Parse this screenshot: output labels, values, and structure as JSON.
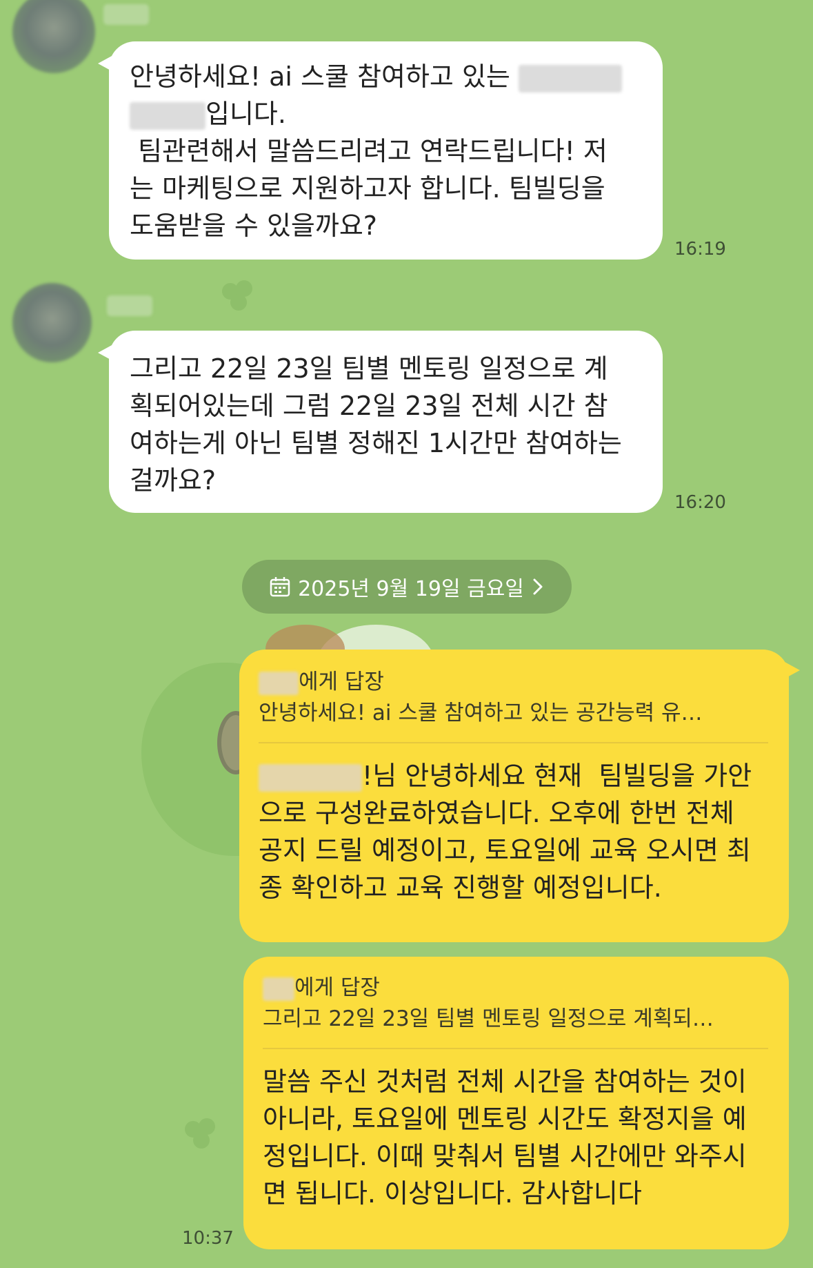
{
  "chat": {
    "messages": [
      {
        "direction": "incoming",
        "text_lines": [
          "안녕하세요! ai 스쿨 참여하고 있는 ",
          "입니다.",
          " 팀관련해서 말씀드리려고 연락드립니다! 저",
          "는 마케팅으로 지원하고자 합니다. 팀빌딩을",
          "도움받을 수 있을까요?"
        ],
        "time": "16:19"
      },
      {
        "direction": "incoming",
        "text_lines": [
          "그리고 22일 23일 팀별 멘토링 일정으로 계",
          "획되어있는데 그럼 22일 23일 전체 시간 참",
          "여하는게 아닌 팀별 정해진 1시간만 참여하는",
          "걸까요?"
        ],
        "time": "16:20"
      }
    ],
    "date_divider": "2025년 9월 19일 금요일",
    "replies": [
      {
        "direction": "outgoing",
        "reply_to_suffix": "에게 답장",
        "quoted": "안녕하세요! ai 스쿨 참여하고 있는 공간능력 유…",
        "text_lines": [
          "!님 안녕하세요 현재  팀빌딩을 가안",
          "으로 구성완료하였습니다. 오후에 한번 전체",
          "공지 드릴 예정이고, 토요일에 교육 오시면 최",
          "종 확인하고 교육 진행할 예정입니다."
        ]
      },
      {
        "direction": "outgoing",
        "reply_to_suffix": "에게 답장",
        "quoted": "그리고 22일 23일 팀별 멘토링 일정으로 계획되…",
        "text_lines": [
          "말씀 주신 것처럼 전체 시간을 참여하는 것이",
          "아니라, 토요일에 멘토링 시간도 확정지을 예",
          "정입니다. 이때 맞춰서 팀별 시간에만 와주시",
          "면 됩니다. 이상입니다. 감사합니다"
        ]
      }
    ],
    "last_time": "10:37"
  },
  "colors": {
    "background": "#9ccb76",
    "incoming_bubble": "#ffffff",
    "outgoing_bubble": "#fbdd3d",
    "date_pill": "#7fa862"
  },
  "icons": {
    "date_icon": "calendar-icon",
    "date_chevron": "chevron-right-icon"
  }
}
